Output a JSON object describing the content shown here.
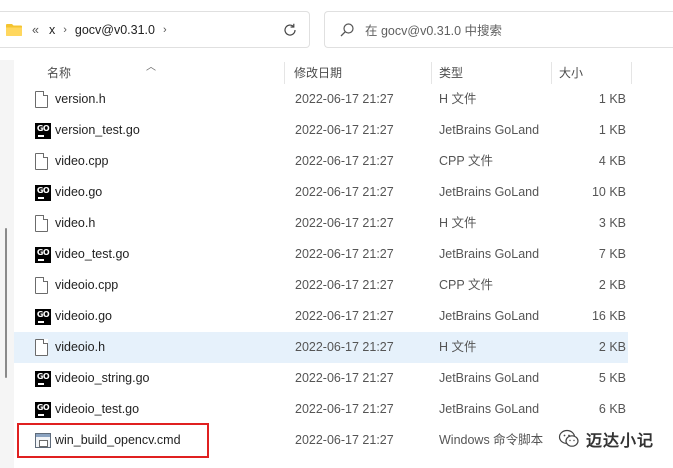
{
  "address_bar": {
    "crumbs": [
      "«",
      "x",
      "gocv@v0.31.0"
    ],
    "separator": "›"
  },
  "search": {
    "placeholder": "在 gocv@v0.31.0 中搜索"
  },
  "columns": {
    "name": "名称",
    "modified": "修改日期",
    "type": "类型",
    "size": "大小"
  },
  "files": [
    {
      "name": "version.h",
      "modified": "2022-06-17 21:27",
      "type": "H 文件",
      "size": "1 KB",
      "icon": "document-icon"
    },
    {
      "name": "version_test.go",
      "modified": "2022-06-17 21:27",
      "type": "JetBrains GoLand",
      "size": "1 KB",
      "icon": "goland-file-icon"
    },
    {
      "name": "video.cpp",
      "modified": "2022-06-17 21:27",
      "type": "CPP 文件",
      "size": "4 KB",
      "icon": "document-icon"
    },
    {
      "name": "video.go",
      "modified": "2022-06-17 21:27",
      "type": "JetBrains GoLand",
      "size": "10 KB",
      "icon": "goland-file-icon"
    },
    {
      "name": "video.h",
      "modified": "2022-06-17 21:27",
      "type": "H 文件",
      "size": "3 KB",
      "icon": "document-icon"
    },
    {
      "name": "video_test.go",
      "modified": "2022-06-17 21:27",
      "type": "JetBrains GoLand",
      "size": "7 KB",
      "icon": "goland-file-icon"
    },
    {
      "name": "videoio.cpp",
      "modified": "2022-06-17 21:27",
      "type": "CPP 文件",
      "size": "2 KB",
      "icon": "document-icon"
    },
    {
      "name": "videoio.go",
      "modified": "2022-06-17 21:27",
      "type": "JetBrains GoLand",
      "size": "16 KB",
      "icon": "goland-file-icon"
    },
    {
      "name": "videoio.h",
      "modified": "2022-06-17 21:27",
      "type": "H 文件",
      "size": "2 KB",
      "icon": "document-icon"
    },
    {
      "name": "videoio_string.go",
      "modified": "2022-06-17 21:27",
      "type": "JetBrains GoLand",
      "size": "5 KB",
      "icon": "goland-file-icon"
    },
    {
      "name": "videoio_test.go",
      "modified": "2022-06-17 21:27",
      "type": "JetBrains GoLand",
      "size": "6 KB",
      "icon": "goland-file-icon"
    },
    {
      "name": "win_build_opencv.cmd",
      "modified": "2022-06-17 21:27",
      "type": "Windows 命令脚本",
      "size": "",
      "icon": "cmd-script-icon"
    }
  ],
  "selected_file": "videoio.h",
  "highlighted_file": "win_build_opencv.cmd",
  "go_icon_text": "GO",
  "watermark": {
    "text": "迈达小记"
  },
  "colors": {
    "selection": "#e6f1fb",
    "highlight_box": "#e02020"
  }
}
